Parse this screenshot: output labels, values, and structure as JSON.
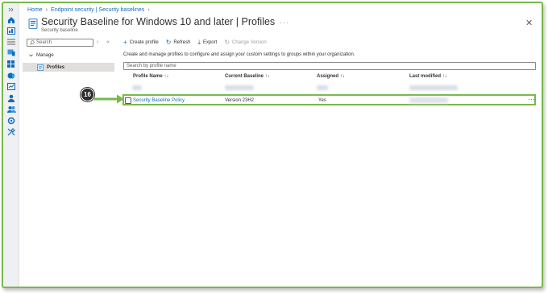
{
  "breadcrumb": [
    "Home",
    "Endpoint security | Security baselines"
  ],
  "page": {
    "title": "Security Baseline for Windows 10 and later | Profiles",
    "subtitle": "Security baseline",
    "more": "···",
    "close": "✕"
  },
  "nav": {
    "search_placeholder": "Search",
    "group_label": "Manage",
    "items": [
      {
        "label": "Profiles"
      }
    ]
  },
  "toolbar": {
    "create": "Create profile",
    "refresh": "Refresh",
    "export": "Export",
    "change_version": "Change Version"
  },
  "description": "Create and manage profiles to configure and assign your custom settings to groups within your organization.",
  "filter_placeholder": "Search by profile name",
  "table": {
    "columns": [
      "Profile Name ↑↓",
      "Current Baseline ↑↓",
      "Assigned ↑↓",
      "Last modified ↑↓"
    ],
    "rows": [
      {
        "name": "Security Baseline Policy",
        "baseline": "Version 23H2",
        "assigned": "Yes"
      }
    ]
  },
  "callout": {
    "step": "16"
  },
  "colors": {
    "accent": "#0f6cbd",
    "highlight": "#78b94a"
  }
}
